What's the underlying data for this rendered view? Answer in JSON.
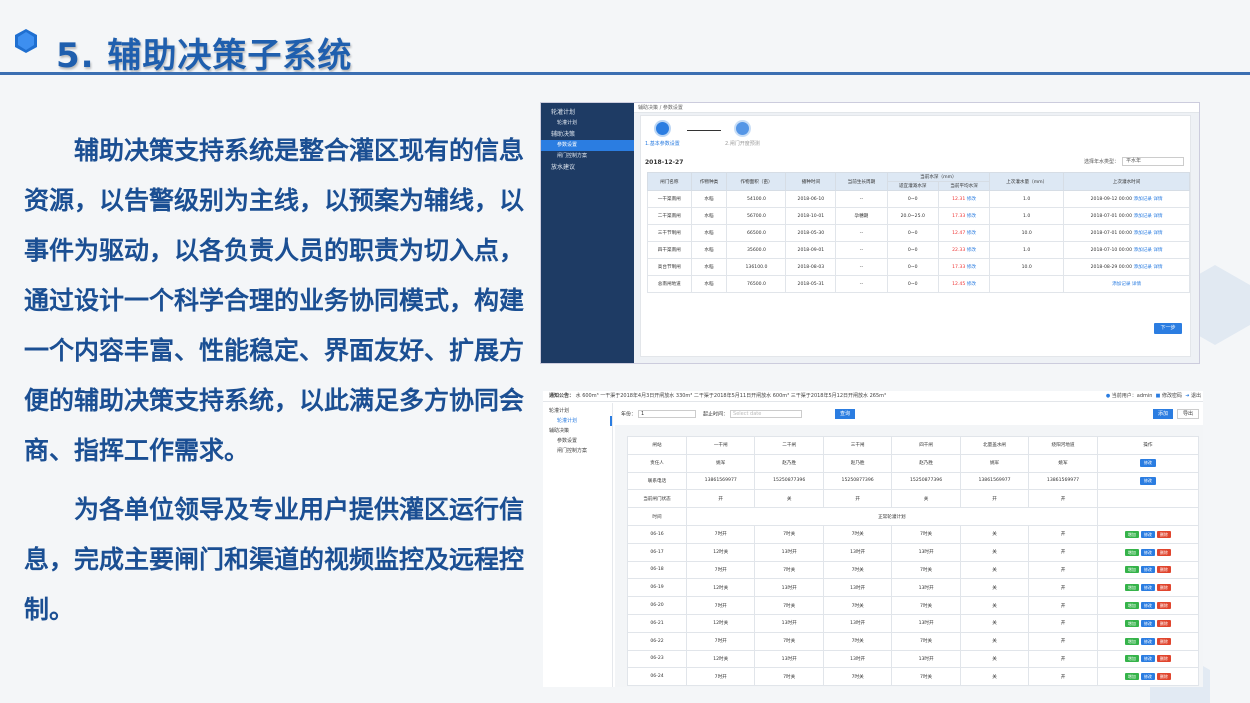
{
  "slide": {
    "title": "5. 辅助决策子系统",
    "paragraph1": "辅助决策支持系统是整合灌区现有的信息资源，以告警级别为主线，以预案为辅线，以事件为驱动，以各负责人员的职责为切入点，通过设计一个科学合理的业务协同模式，构建一个内容丰富、性能稳定、界面友好、扩展方便的辅助决策支持系统，以此满足多方协同会商、指挥工作需求。",
    "paragraph2": "为各单位领导及专业用户提供灌区运行信息，完成主要闸门和渠道的视频监控及远程控制。",
    "colors": {
      "title": "#1f5fae",
      "text": "#1b4f93",
      "accent": "#3b6fb2"
    }
  },
  "screen1": {
    "sidebar": [
      "轮灌计划",
      "轮灌计划",
      "辅助决策",
      "参数设置",
      "闸门控制方案",
      "放水建议"
    ],
    "breadcrumb": "辅助决策 / 参数设置",
    "steps": [
      "1.基本参数设置",
      "2.闸门开度预测"
    ],
    "date": "2018-12-27",
    "select_label": "选择年水类型：",
    "select_value": "平水年",
    "headers": [
      "闸门名称",
      "作物种类",
      "作物面积（亩）",
      "播种时间",
      "当前生长周期",
      "当前水深（mm）",
      "适宜灌溉水深",
      "当前平均水深",
      "上次灌水量（mm）",
      "上次灌水时间"
    ],
    "rows": [
      [
        "一干渠南闸",
        "水稻",
        "54100.0",
        "2018-06-10",
        "--",
        "0~0",
        "12.31",
        "修改",
        "1.0",
        "2018-09-12 00:00",
        "添加记录",
        "详情"
      ],
      [
        "二干渠南闸",
        "水稻",
        "56700.0",
        "2018-10-01",
        "孕穗期",
        "20.0~25.0",
        "17.33",
        "修改",
        "1.0",
        "2018-07-01 00:00",
        "添加记录",
        "详情"
      ],
      [
        "三干节制闸",
        "水稻",
        "66500.0",
        "2018-05-30",
        "--",
        "0~0",
        "12.47",
        "修改",
        "10.0",
        "2018-07-01 00:00",
        "添加记录",
        "详情"
      ],
      [
        "四干渠南闸",
        "水稻",
        "35600.0",
        "2018-09-01",
        "--",
        "0~0",
        "22.33",
        "修改",
        "1.0",
        "2018-07-10 00:00",
        "添加记录",
        "详情"
      ],
      [
        "高台节制闸",
        "水稻",
        "136100.0",
        "2018-08-03",
        "--",
        "0~0",
        "17.33",
        "修改",
        "10.0",
        "2018-08-29 00:00",
        "添加记录",
        "详情"
      ],
      [
        "总南闸地道",
        "水稻",
        "76500.0",
        "2018-05-31",
        "--",
        "0~0",
        "12.45",
        "修改",
        "",
        "",
        "添加记录",
        "详情"
      ]
    ],
    "next_button": "下一步"
  },
  "screen2": {
    "notice_label": "通知公告：",
    "notice": "水 600m³     一干渠于2018年4月3日开闸放水 330m³     二干渠于2018年5月11日开闸放水 600m³     三干渠于2018年5月12日开闸放水 265m³",
    "user": "当前用户：admin",
    "change_pwd": "修改密码",
    "logout": "退出",
    "sidebar": [
      "轮灌计划",
      "轮灌计划",
      "辅助决策",
      "参数设置",
      "闸门控制方案"
    ],
    "year_label": "年份：",
    "year_value": "1",
    "start_label": "起止时间：",
    "start_placeholder": "Select date",
    "query_button": "查询",
    "add_button": "添加",
    "export_button": "导出",
    "headers": [
      "闸站",
      "一干闸",
      "二干闸",
      "三干闸",
      "四干闸",
      "北量盖水闸",
      "绕阳河地道",
      "操作"
    ],
    "owner": [
      "责任人",
      "姚军",
      "赵乃胜",
      "赵乃胜",
      "赵乃胜",
      "姚军",
      "姚军"
    ],
    "phone": [
      "联系电话",
      "13861569977",
      "15250877396",
      "15250877396",
      "15250877396",
      "13861569977",
      "13861569977"
    ],
    "gate_state": [
      "当前闸门状态",
      "开",
      "关",
      "开",
      "关",
      "开",
      "开"
    ],
    "time_label": "时间",
    "plan_label": "正常轮灌计划",
    "modify": "修改",
    "ops": [
      "增加",
      "修改",
      "删除"
    ],
    "rows": [
      [
        "06-16",
        "7时开",
        "7时关",
        "7时关",
        "7时关",
        "关",
        "开"
      ],
      [
        "06-17",
        "12时关",
        "13时开",
        "13时开",
        "13时开",
        "关",
        "开"
      ],
      [
        "06-18",
        "7时开",
        "7时关",
        "7时关",
        "7时关",
        "关",
        "开"
      ],
      [
        "06-19",
        "12时关",
        "13时开",
        "13时开",
        "13时开",
        "关",
        "开"
      ],
      [
        "06-20",
        "7时开",
        "7时关",
        "7时关",
        "7时关",
        "关",
        "开"
      ],
      [
        "06-21",
        "12时关",
        "13时开",
        "13时开",
        "13时开",
        "关",
        "开"
      ],
      [
        "06-22",
        "7时开",
        "7时关",
        "7时关",
        "7时关",
        "关",
        "开"
      ],
      [
        "06-23",
        "12时关",
        "13时开",
        "13时开",
        "13时开",
        "关",
        "开"
      ],
      [
        "06-24",
        "7时开",
        "7时关",
        "7时关",
        "7时关",
        "关",
        "开"
      ]
    ]
  }
}
